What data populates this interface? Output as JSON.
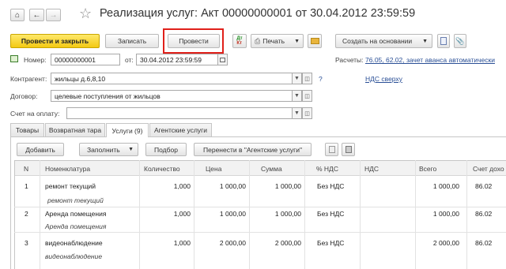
{
  "window": {
    "title": "Реализация услуг: Акт 00000000001 от 30.04.2012 23:59:59"
  },
  "toolbar": {
    "post_and_close": "Провести и закрыть",
    "save": "Записать",
    "post": "Провести",
    "print": "Печать",
    "create_based_on": "Создать на основании"
  },
  "header": {
    "number_label": "Номер:",
    "number_value": "00000000001",
    "date_label": "от:",
    "date_value": "30.04.2012 23:59:59",
    "settlements_label": "Расчеты:",
    "settlements_link": "76.05, 62.02, зачет аванса автоматически",
    "contractor_label": "Контрагент:",
    "contractor_value": "жильцы д.6,8,10",
    "help": "?",
    "vat_link": "НДС сверху",
    "contract_label": "Договор:",
    "contract_value": "целевые поступления от жильцов",
    "invoice_label": "Счет на оплату:",
    "invoice_value": ""
  },
  "tabs": [
    {
      "label": "Товары"
    },
    {
      "label": "Возвратная тара"
    },
    {
      "label": "Услуги (9)"
    },
    {
      "label": "Агентские услуги"
    }
  ],
  "table_toolbar": {
    "add": "Добавить",
    "fill": "Заполнить",
    "select": "Подбор",
    "move": "Перенести в \"Агентские услуги\""
  },
  "table": {
    "columns": [
      "N",
      "Номенклатура",
      "Количество",
      "Цена",
      "Сумма",
      "% НДС",
      "НДС",
      "Всего",
      "Счет дохо"
    ],
    "rows": [
      {
        "n": "1",
        "name": "ремонт текущий",
        "content": "ремонт текущий",
        "qty": "1,000",
        "price": "1 000,00",
        "sum": "1 000,00",
        "vat_rate": "Без НДС",
        "vat": "",
        "total": "1 000,00",
        "account": "86.02"
      },
      {
        "n": "2",
        "name": "Аренда помещения",
        "content": "Аренда помещения",
        "qty": "1,000",
        "price": "1 000,00",
        "sum": "1 000,00",
        "vat_rate": "Без НДС",
        "vat": "",
        "total": "1 000,00",
        "account": "86.02"
      },
      {
        "n": "3",
        "name": "видеонаблюдение",
        "content": "видеонаблюдение",
        "qty": "1,000",
        "price": "2 000,00",
        "sum": "2 000,00",
        "vat_rate": "Без НДС",
        "vat": "",
        "total": "2 000,00",
        "account": "86.02"
      }
    ]
  },
  "colors": {
    "primary_button": "#f3c913",
    "highlight_border": "#e0201a",
    "link": "#2a4f96",
    "title_text": "#333333"
  }
}
